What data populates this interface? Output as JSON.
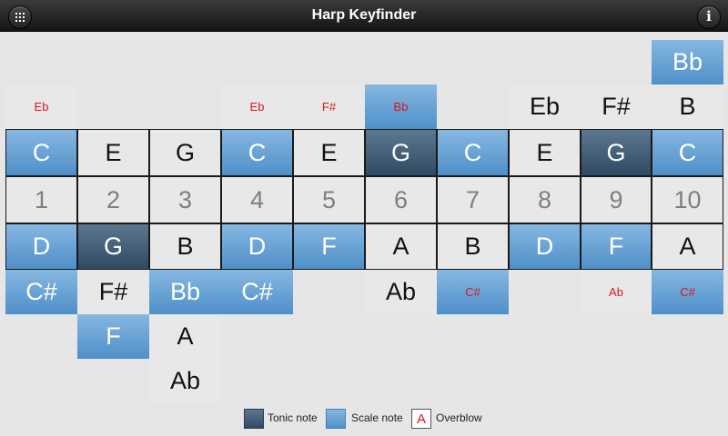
{
  "app": {
    "title": "Harp Keyfinder",
    "menu_icon": "grid-menu-icon",
    "info_icon": "info-icon",
    "info_glyph": "i"
  },
  "colors": {
    "tonic": "#3d5a74",
    "scale": "#5f9fd6",
    "overblow_text": "#e0141e",
    "plain_cell": "#e8e8e8",
    "number_text": "#7f7f7f"
  },
  "harp": {
    "holes": [
      "1",
      "2",
      "3",
      "4",
      "5",
      "6",
      "7",
      "8",
      "9",
      "10"
    ],
    "blow_bends": [
      "",
      "",
      "",
      "",
      "",
      "",
      "",
      "",
      "",
      "Bb"
    ],
    "overblows_and_upper": [
      "Eb",
      "",
      "",
      "Eb",
      "F#",
      "Bb",
      "",
      "Eb",
      "F#",
      "B"
    ],
    "blow": [
      "C",
      "E",
      "G",
      "C",
      "E",
      "G",
      "C",
      "E",
      "G",
      "C"
    ],
    "draw": [
      "D",
      "G",
      "B",
      "D",
      "F",
      "A",
      "B",
      "D",
      "F",
      "A"
    ],
    "draw_bend_1": [
      "C#",
      "F#",
      "Bb",
      "C#",
      "",
      "Ab",
      "C#",
      "",
      "Ab",
      "C#"
    ],
    "draw_bend_2": [
      "",
      "F",
      "A",
      "",
      "",
      "",
      "",
      "",
      "",
      ""
    ],
    "draw_bend_3": [
      "",
      "",
      "Ab",
      "",
      "",
      "",
      "",
      "",
      "",
      ""
    ]
  },
  "legend": {
    "tonic_label": "Tonic note",
    "scale_label": "Scale note",
    "overblow_label": "Overblow",
    "overblow_sample": "A"
  }
}
